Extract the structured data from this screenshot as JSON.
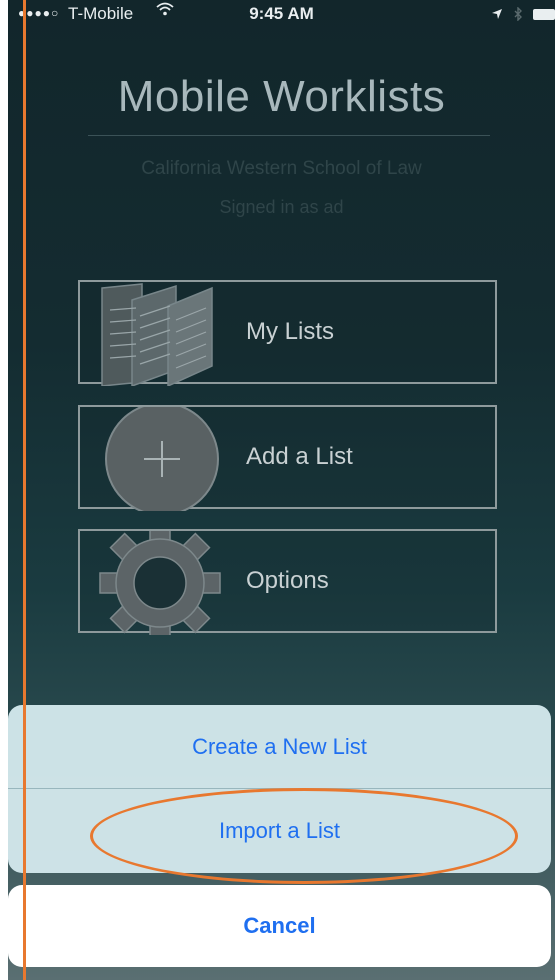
{
  "status_bar": {
    "signal": "●●●●○",
    "carrier": "T-Mobile",
    "time": "9:45 AM"
  },
  "header": {
    "title": "Mobile Worklists",
    "school": "California Western School of Law",
    "signed_in": "Signed in as ad"
  },
  "menu": {
    "items": [
      {
        "label": "My Lists",
        "icon": "documents-icon"
      },
      {
        "label": "Add a List",
        "icon": "plus-circle-icon"
      },
      {
        "label": "Options",
        "icon": "gear-icon"
      }
    ]
  },
  "action_sheet": {
    "options": [
      "Create a New List",
      "Import a List"
    ],
    "cancel": "Cancel"
  },
  "colors": {
    "accent": "#1f6ff0",
    "annotation": "#e8782f",
    "background": "#142c31"
  }
}
